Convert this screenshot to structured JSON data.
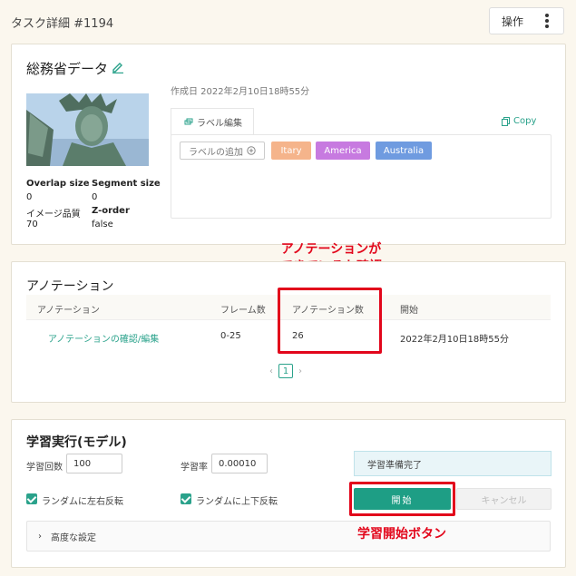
{
  "header": {
    "title": "タスク詳細 #1194",
    "ops_label": "操作"
  },
  "task": {
    "name": "総務省データ",
    "created": "作成日 2022年2月10日18時55分",
    "meta": {
      "overlap_label": "Overlap size",
      "overlap_value": "0",
      "segment_label": "Segment size",
      "segment_value": "0",
      "quality_label": "イメージ品質",
      "quality_value": "70",
      "zorder_label": "Z-order",
      "zorder_value": "false"
    }
  },
  "labels": {
    "tab_label": "ラベル編集",
    "copy_label": "Copy",
    "add_label": "ラベルの追加",
    "chips": [
      {
        "text": "Itary",
        "color": "#f5b48b"
      },
      {
        "text": "America",
        "color": "#c77ae0"
      },
      {
        "text": "Australia",
        "color": "#6f9be0"
      }
    ]
  },
  "annotation": {
    "title": "アノテーション",
    "headers": [
      "アノテーション",
      "フレーム数",
      "アノテーション数",
      "開始"
    ],
    "row": {
      "link": "アノテーションの確認/編集",
      "frames": "0-25",
      "count": "26",
      "start": "2022年2月10日18時55分"
    },
    "page": "1",
    "prev": "‹",
    "next": "›"
  },
  "training": {
    "title": "学習実行(モデル)",
    "iter_label": "学習回数",
    "iter_value": "100",
    "lr_label": "学習率",
    "lr_value": "0.00010",
    "status": "学習準備完了",
    "flip_h": "ランダムに左右反転",
    "flip_v": "ランダムに上下反転",
    "start": "開始",
    "cancel": "キャンセル",
    "advanced": "高度な設定"
  },
  "callouts": {
    "annotation_note": "アノテーションが\nできているか確認",
    "start_note": "学習開始ボタン"
  },
  "colors": {
    "accent": "#1e9e85",
    "highlight": "#e2061b"
  }
}
